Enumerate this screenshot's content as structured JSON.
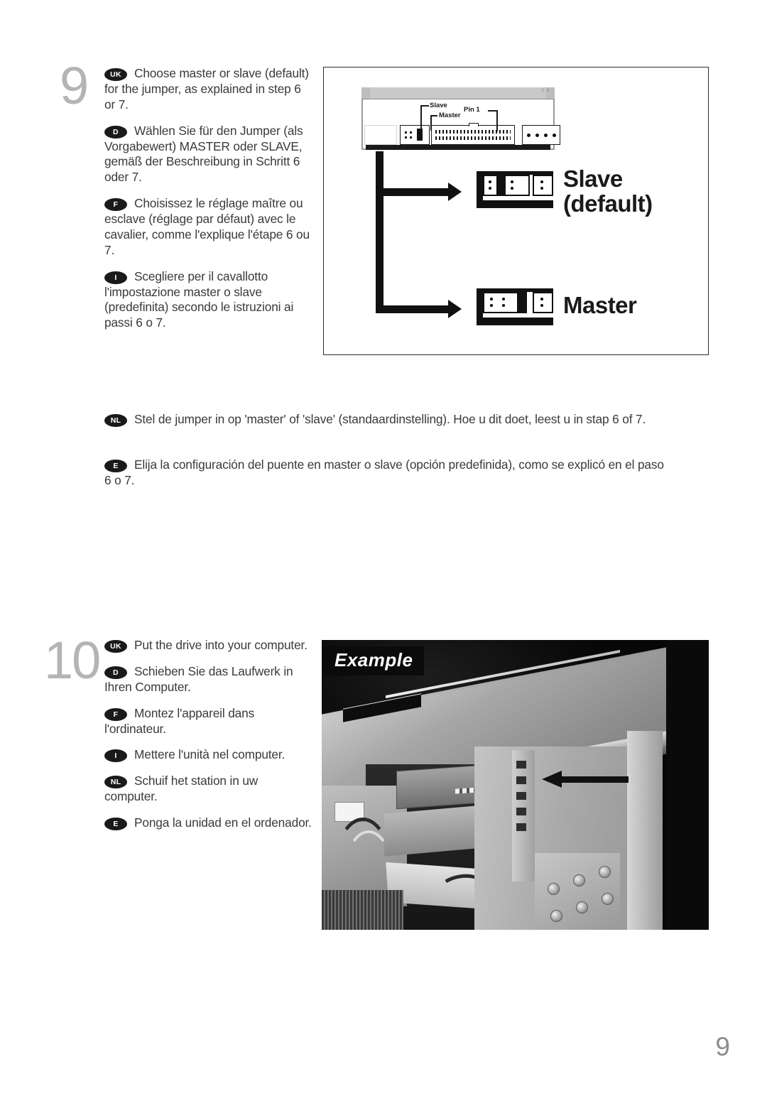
{
  "page": {
    "number": "9"
  },
  "steps": [
    {
      "number": "9",
      "paragraphs": [
        {
          "badge": "UK",
          "text": "Choose master or slave (default) for the jumper, as explained in step 6 or 7."
        },
        {
          "badge": "D",
          "text": "Wählen Sie für den Jumper (als Vorgabewert) MASTER oder SLAVE, gemäß der Beschreibung in Schritt 6 oder 7."
        },
        {
          "badge": "F",
          "text": "Choisissez le réglage maître ou esclave (réglage par défaut) avec le cavalier, comme l'explique l'étape 6 ou 7."
        },
        {
          "badge": "I",
          "text": "Scegliere per il cavallotto l'impostazione master o slave (predefinita) secondo le istruzioni ai passi 6 o 7."
        }
      ],
      "wide_paragraphs": [
        {
          "badge": "NL",
          "text": "Stel de jumper in op 'master' of 'slave' (standaardinstelling). Hoe u dit doet, leest u in stap 6 of 7."
        },
        {
          "badge": "E",
          "text": "Elija la configuración del puente en master o slave (opción predefinida), como se explicó en el paso 6 o 7."
        }
      ]
    },
    {
      "number": "10",
      "paragraphs": [
        {
          "badge": "UK",
          "text": "Put the drive into your computer."
        },
        {
          "badge": "D",
          "text": "Schieben Sie das Laufwerk in Ihren Computer."
        },
        {
          "badge": "F",
          "text": "Montez l'appareil dans l'ordinateur."
        },
        {
          "badge": "I",
          "text": "Mettere l'unità nel computer."
        },
        {
          "badge": "NL",
          "text": "Schuif het station in uw computer."
        },
        {
          "badge": "E",
          "text": "Ponga la unidad en el ordenador."
        }
      ]
    }
  ],
  "diagram": {
    "drive_callouts": {
      "slave": "Slave",
      "master": "Master",
      "pin1": "Pin 1"
    },
    "jumper_settings": [
      {
        "label": "Slave\n(default)",
        "position": "middle"
      },
      {
        "label": "Master",
        "position": "right"
      }
    ]
  },
  "photo": {
    "example_label": "Example"
  },
  "colors": {
    "text": "#3a3a3a",
    "step_number": "#b4b4b4",
    "badge_bg": "#1a1a1a",
    "badge_text": "#ffffff",
    "page_number": "#8c8c8c",
    "diagram_border": "#2b2b2b"
  }
}
